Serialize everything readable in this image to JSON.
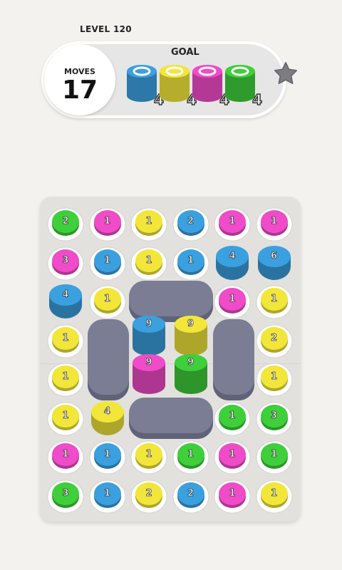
{
  "header": {
    "level": "LEVEL 120"
  },
  "moves": {
    "label": "MOVES",
    "value": "17"
  },
  "goal": {
    "label": "GOAL",
    "items": [
      {
        "color": "blue",
        "count": "4"
      },
      {
        "color": "yellow",
        "count": "4"
      },
      {
        "color": "pink",
        "count": "4"
      },
      {
        "color": "green",
        "count": "4"
      }
    ]
  },
  "palette": {
    "blue": "#3aa0e0",
    "yellow": "#f2e63a",
    "pink": "#f04bc8",
    "green": "#3ecf3a"
  },
  "board": {
    "cells": [
      {
        "row": 0,
        "col": 0,
        "color": "green",
        "n": "2",
        "style": "flat"
      },
      {
        "row": 0,
        "col": 1,
        "color": "pink",
        "n": "1",
        "style": "flat"
      },
      {
        "row": 0,
        "col": 2,
        "color": "yellow",
        "n": "1",
        "style": "flat"
      },
      {
        "row": 0,
        "col": 3,
        "color": "blue",
        "n": "2",
        "style": "flat"
      },
      {
        "row": 0,
        "col": 4,
        "color": "pink",
        "n": "1",
        "style": "flat"
      },
      {
        "row": 0,
        "col": 5,
        "color": "pink",
        "n": "1",
        "style": "flat"
      },
      {
        "row": 1,
        "col": 0,
        "color": "pink",
        "n": "3",
        "style": "flat"
      },
      {
        "row": 1,
        "col": 1,
        "color": "blue",
        "n": "1",
        "style": "flat"
      },
      {
        "row": 1,
        "col": 2,
        "color": "yellow",
        "n": "1",
        "style": "flat"
      },
      {
        "row": 1,
        "col": 3,
        "color": "blue",
        "n": "1",
        "style": "flat"
      },
      {
        "row": 1,
        "col": 4,
        "color": "blue",
        "n": "4",
        "style": "tall"
      },
      {
        "row": 1,
        "col": 5,
        "color": "blue",
        "n": "6",
        "style": "tall"
      },
      {
        "row": 2,
        "col": 0,
        "color": "blue",
        "n": "4",
        "style": "tall"
      },
      {
        "row": 2,
        "col": 1,
        "color": "yellow",
        "n": "1",
        "style": "flat"
      },
      {
        "row": 2,
        "col": 4,
        "color": "pink",
        "n": "1",
        "style": "flat"
      },
      {
        "row": 2,
        "col": 5,
        "color": "yellow",
        "n": "1",
        "style": "flat"
      },
      {
        "row": 3,
        "col": 0,
        "color": "yellow",
        "n": "1",
        "style": "flat"
      },
      {
        "row": 3,
        "col": 2,
        "color": "blue",
        "n": "9",
        "style": "tower"
      },
      {
        "row": 3,
        "col": 3,
        "color": "yellow",
        "n": "9",
        "style": "tower"
      },
      {
        "row": 3,
        "col": 5,
        "color": "yellow",
        "n": "2",
        "style": "flat"
      },
      {
        "row": 4,
        "col": 0,
        "color": "yellow",
        "n": "1",
        "style": "flat"
      },
      {
        "row": 4,
        "col": 2,
        "color": "pink",
        "n": "9",
        "style": "tower"
      },
      {
        "row": 4,
        "col": 3,
        "color": "green",
        "n": "9",
        "style": "tower"
      },
      {
        "row": 4,
        "col": 5,
        "color": "yellow",
        "n": "1",
        "style": "flat"
      },
      {
        "row": 5,
        "col": 0,
        "color": "yellow",
        "n": "1",
        "style": "flat"
      },
      {
        "row": 5,
        "col": 1,
        "color": "yellow",
        "n": "4",
        "style": "tall"
      },
      {
        "row": 5,
        "col": 4,
        "color": "green",
        "n": "1",
        "style": "flat"
      },
      {
        "row": 5,
        "col": 5,
        "color": "green",
        "n": "3",
        "style": "flat"
      },
      {
        "row": 6,
        "col": 0,
        "color": "pink",
        "n": "1",
        "style": "flat"
      },
      {
        "row": 6,
        "col": 1,
        "color": "blue",
        "n": "1",
        "style": "flat"
      },
      {
        "row": 6,
        "col": 2,
        "color": "yellow",
        "n": "1",
        "style": "flat"
      },
      {
        "row": 6,
        "col": 3,
        "color": "green",
        "n": "1",
        "style": "flat"
      },
      {
        "row": 6,
        "col": 4,
        "color": "pink",
        "n": "1",
        "style": "flat"
      },
      {
        "row": 6,
        "col": 5,
        "color": "green",
        "n": "1",
        "style": "flat"
      },
      {
        "row": 7,
        "col": 0,
        "color": "green",
        "n": "3",
        "style": "flat"
      },
      {
        "row": 7,
        "col": 1,
        "color": "blue",
        "n": "1",
        "style": "flat"
      },
      {
        "row": 7,
        "col": 2,
        "color": "yellow",
        "n": "2",
        "style": "flat"
      },
      {
        "row": 7,
        "col": 3,
        "color": "blue",
        "n": "2",
        "style": "flat"
      },
      {
        "row": 7,
        "col": 4,
        "color": "pink",
        "n": "1",
        "style": "flat"
      },
      {
        "row": 7,
        "col": 5,
        "color": "yellow",
        "n": "1",
        "style": "flat"
      }
    ]
  }
}
